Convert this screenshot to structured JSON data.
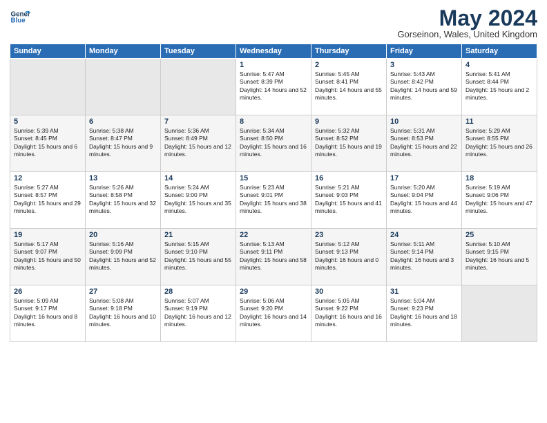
{
  "logo": {
    "line1": "General",
    "line2": "Blue"
  },
  "title": "May 2024",
  "location": "Gorseinon, Wales, United Kingdom",
  "days_of_week": [
    "Sunday",
    "Monday",
    "Tuesday",
    "Wednesday",
    "Thursday",
    "Friday",
    "Saturday"
  ],
  "weeks": [
    [
      {
        "day": "",
        "info": ""
      },
      {
        "day": "",
        "info": ""
      },
      {
        "day": "",
        "info": ""
      },
      {
        "day": "1",
        "info": "Sunrise: 5:47 AM\nSunset: 8:39 PM\nDaylight: 14 hours and 52 minutes."
      },
      {
        "day": "2",
        "info": "Sunrise: 5:45 AM\nSunset: 8:41 PM\nDaylight: 14 hours and 55 minutes."
      },
      {
        "day": "3",
        "info": "Sunrise: 5:43 AM\nSunset: 8:42 PM\nDaylight: 14 hours and 59 minutes."
      },
      {
        "day": "4",
        "info": "Sunrise: 5:41 AM\nSunset: 8:44 PM\nDaylight: 15 hours and 2 minutes."
      }
    ],
    [
      {
        "day": "5",
        "info": "Sunrise: 5:39 AM\nSunset: 8:45 PM\nDaylight: 15 hours and 6 minutes."
      },
      {
        "day": "6",
        "info": "Sunrise: 5:38 AM\nSunset: 8:47 PM\nDaylight: 15 hours and 9 minutes."
      },
      {
        "day": "7",
        "info": "Sunrise: 5:36 AM\nSunset: 8:49 PM\nDaylight: 15 hours and 12 minutes."
      },
      {
        "day": "8",
        "info": "Sunrise: 5:34 AM\nSunset: 8:50 PM\nDaylight: 15 hours and 16 minutes."
      },
      {
        "day": "9",
        "info": "Sunrise: 5:32 AM\nSunset: 8:52 PM\nDaylight: 15 hours and 19 minutes."
      },
      {
        "day": "10",
        "info": "Sunrise: 5:31 AM\nSunset: 8:53 PM\nDaylight: 15 hours and 22 minutes."
      },
      {
        "day": "11",
        "info": "Sunrise: 5:29 AM\nSunset: 8:55 PM\nDaylight: 15 hours and 26 minutes."
      }
    ],
    [
      {
        "day": "12",
        "info": "Sunrise: 5:27 AM\nSunset: 8:57 PM\nDaylight: 15 hours and 29 minutes."
      },
      {
        "day": "13",
        "info": "Sunrise: 5:26 AM\nSunset: 8:58 PM\nDaylight: 15 hours and 32 minutes."
      },
      {
        "day": "14",
        "info": "Sunrise: 5:24 AM\nSunset: 9:00 PM\nDaylight: 15 hours and 35 minutes."
      },
      {
        "day": "15",
        "info": "Sunrise: 5:23 AM\nSunset: 9:01 PM\nDaylight: 15 hours and 38 minutes."
      },
      {
        "day": "16",
        "info": "Sunrise: 5:21 AM\nSunset: 9:03 PM\nDaylight: 15 hours and 41 minutes."
      },
      {
        "day": "17",
        "info": "Sunrise: 5:20 AM\nSunset: 9:04 PM\nDaylight: 15 hours and 44 minutes."
      },
      {
        "day": "18",
        "info": "Sunrise: 5:19 AM\nSunset: 9:06 PM\nDaylight: 15 hours and 47 minutes."
      }
    ],
    [
      {
        "day": "19",
        "info": "Sunrise: 5:17 AM\nSunset: 9:07 PM\nDaylight: 15 hours and 50 minutes."
      },
      {
        "day": "20",
        "info": "Sunrise: 5:16 AM\nSunset: 9:09 PM\nDaylight: 15 hours and 52 minutes."
      },
      {
        "day": "21",
        "info": "Sunrise: 5:15 AM\nSunset: 9:10 PM\nDaylight: 15 hours and 55 minutes."
      },
      {
        "day": "22",
        "info": "Sunrise: 5:13 AM\nSunset: 9:11 PM\nDaylight: 15 hours and 58 minutes."
      },
      {
        "day": "23",
        "info": "Sunrise: 5:12 AM\nSunset: 9:13 PM\nDaylight: 16 hours and 0 minutes."
      },
      {
        "day": "24",
        "info": "Sunrise: 5:11 AM\nSunset: 9:14 PM\nDaylight: 16 hours and 3 minutes."
      },
      {
        "day": "25",
        "info": "Sunrise: 5:10 AM\nSunset: 9:15 PM\nDaylight: 16 hours and 5 minutes."
      }
    ],
    [
      {
        "day": "26",
        "info": "Sunrise: 5:09 AM\nSunset: 9:17 PM\nDaylight: 16 hours and 8 minutes."
      },
      {
        "day": "27",
        "info": "Sunrise: 5:08 AM\nSunset: 9:18 PM\nDaylight: 16 hours and 10 minutes."
      },
      {
        "day": "28",
        "info": "Sunrise: 5:07 AM\nSunset: 9:19 PM\nDaylight: 16 hours and 12 minutes."
      },
      {
        "day": "29",
        "info": "Sunrise: 5:06 AM\nSunset: 9:20 PM\nDaylight: 16 hours and 14 minutes."
      },
      {
        "day": "30",
        "info": "Sunrise: 5:05 AM\nSunset: 9:22 PM\nDaylight: 16 hours and 16 minutes."
      },
      {
        "day": "31",
        "info": "Sunrise: 5:04 AM\nSunset: 9:23 PM\nDaylight: 16 hours and 18 minutes."
      },
      {
        "day": "",
        "info": ""
      }
    ]
  ]
}
